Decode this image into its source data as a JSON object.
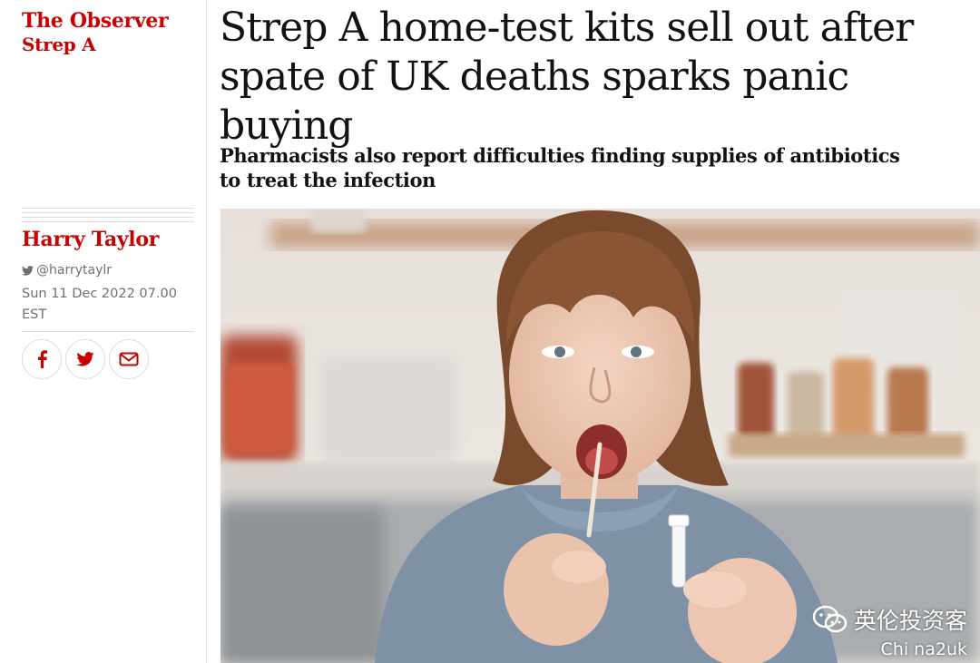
{
  "brand": {
    "name": "The Observer",
    "section": "Strep A"
  },
  "headline": "Strep A home-test kits sell out after spate of UK deaths sparks panic buying",
  "standfirst": "Pharmacists also report difficulties finding supplies of antibiotics to treat the infection",
  "byline": {
    "author": "Harry Taylor",
    "twitter": "@harrytaylr",
    "date": "Sun 11 Dec 2022 07.00 EST"
  },
  "share": [
    {
      "icon": "facebook-icon",
      "label": "Share on Facebook"
    },
    {
      "icon": "twitter-icon",
      "label": "Share on Twitter"
    },
    {
      "icon": "email-icon",
      "label": "Share via Email"
    }
  ],
  "watermark": {
    "channel": "英伦投资客",
    "handle": "Chi na2uk"
  },
  "colors": {
    "accent": "#c70000",
    "text": "#121212",
    "meta": "#707070",
    "rule": "#dcdcdc"
  }
}
